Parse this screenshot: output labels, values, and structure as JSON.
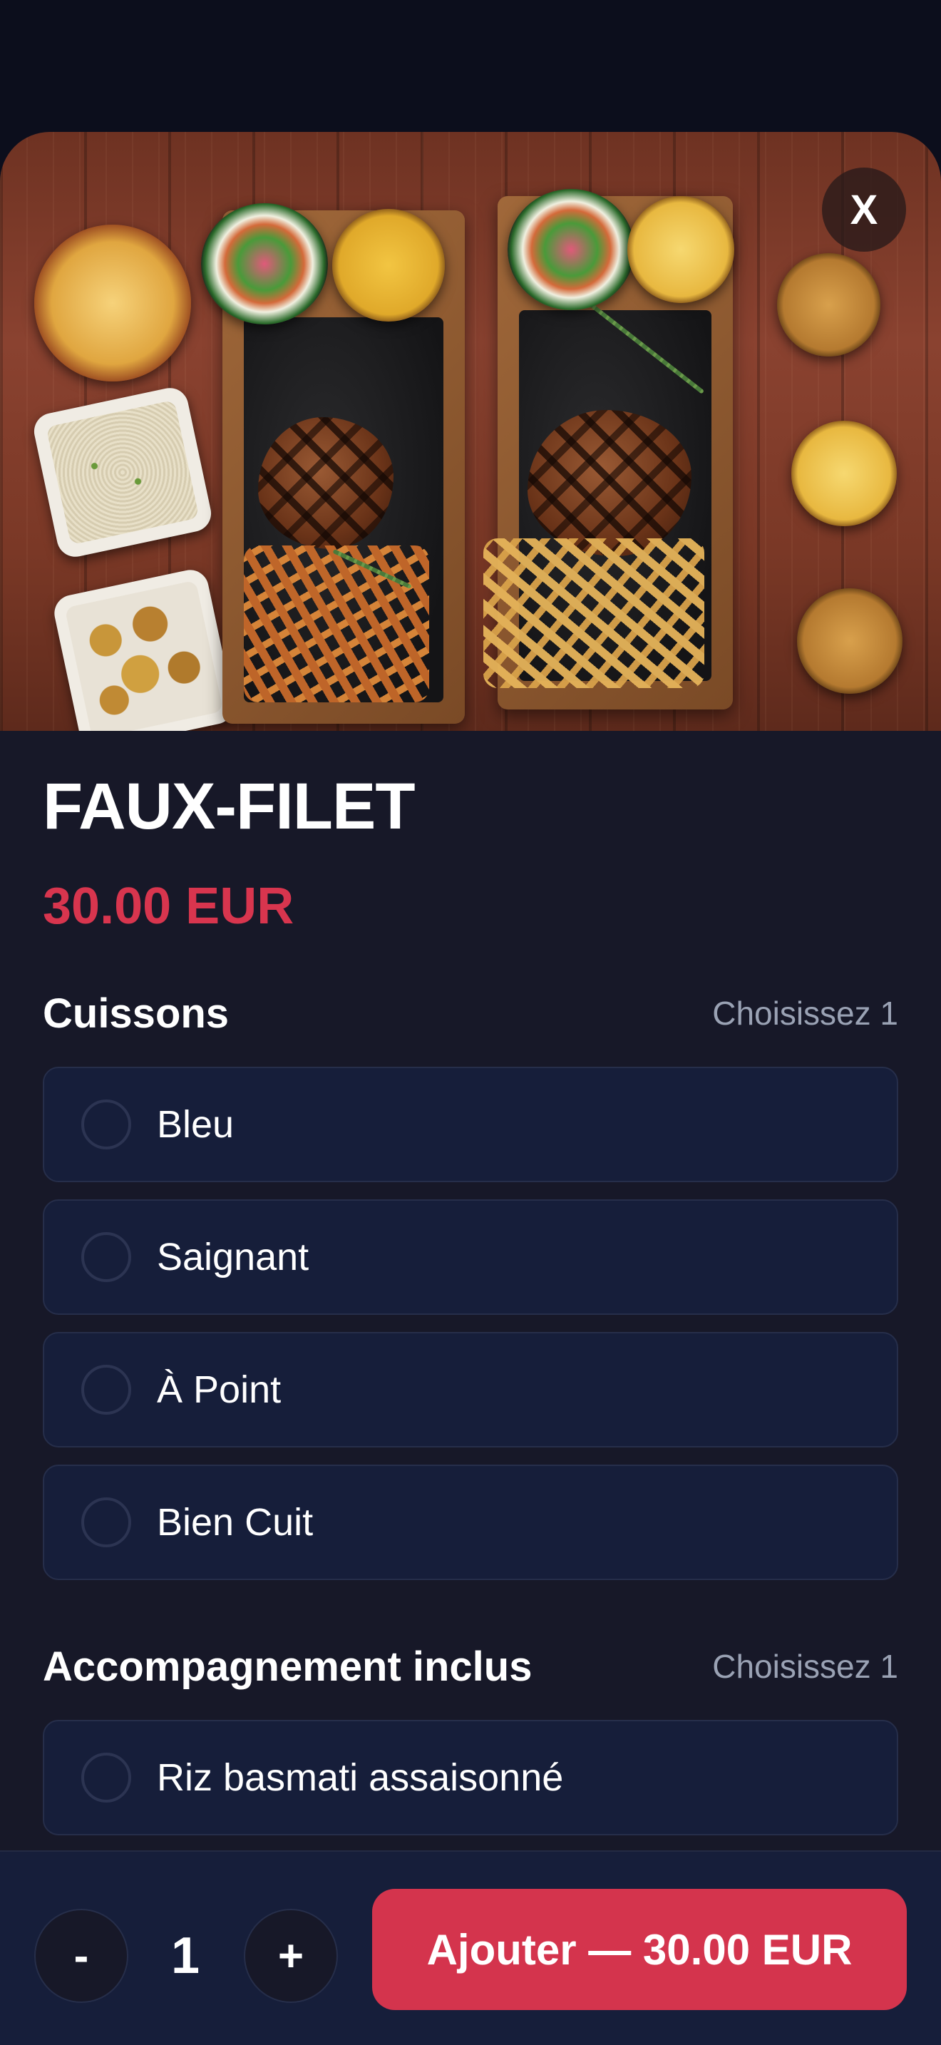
{
  "product": {
    "name": "FAUX-FILET",
    "price": "30.00 EUR",
    "close_label": "X"
  },
  "sections": [
    {
      "title": "Cuissons",
      "hint": "Choisissez 1",
      "options": [
        {
          "label": "Bleu",
          "selected": false
        },
        {
          "label": "Saignant",
          "selected": false
        },
        {
          "label": "À Point",
          "selected": false
        },
        {
          "label": "Bien Cuit",
          "selected": false
        }
      ]
    },
    {
      "title": "Accompagnement inclus",
      "hint": "Choisissez 1",
      "options": [
        {
          "label": "Riz basmati assaisonné",
          "selected": false
        }
      ]
    }
  ],
  "footer": {
    "minus_label": "-",
    "quantity": "1",
    "plus_label": "+",
    "add_label": "Ajouter — 30.00 EUR"
  },
  "colors": {
    "accent": "#d4344d",
    "price": "#d8354e",
    "background": "#171828",
    "option_bg": "#161e3a",
    "hint": "#9aa2b4"
  }
}
